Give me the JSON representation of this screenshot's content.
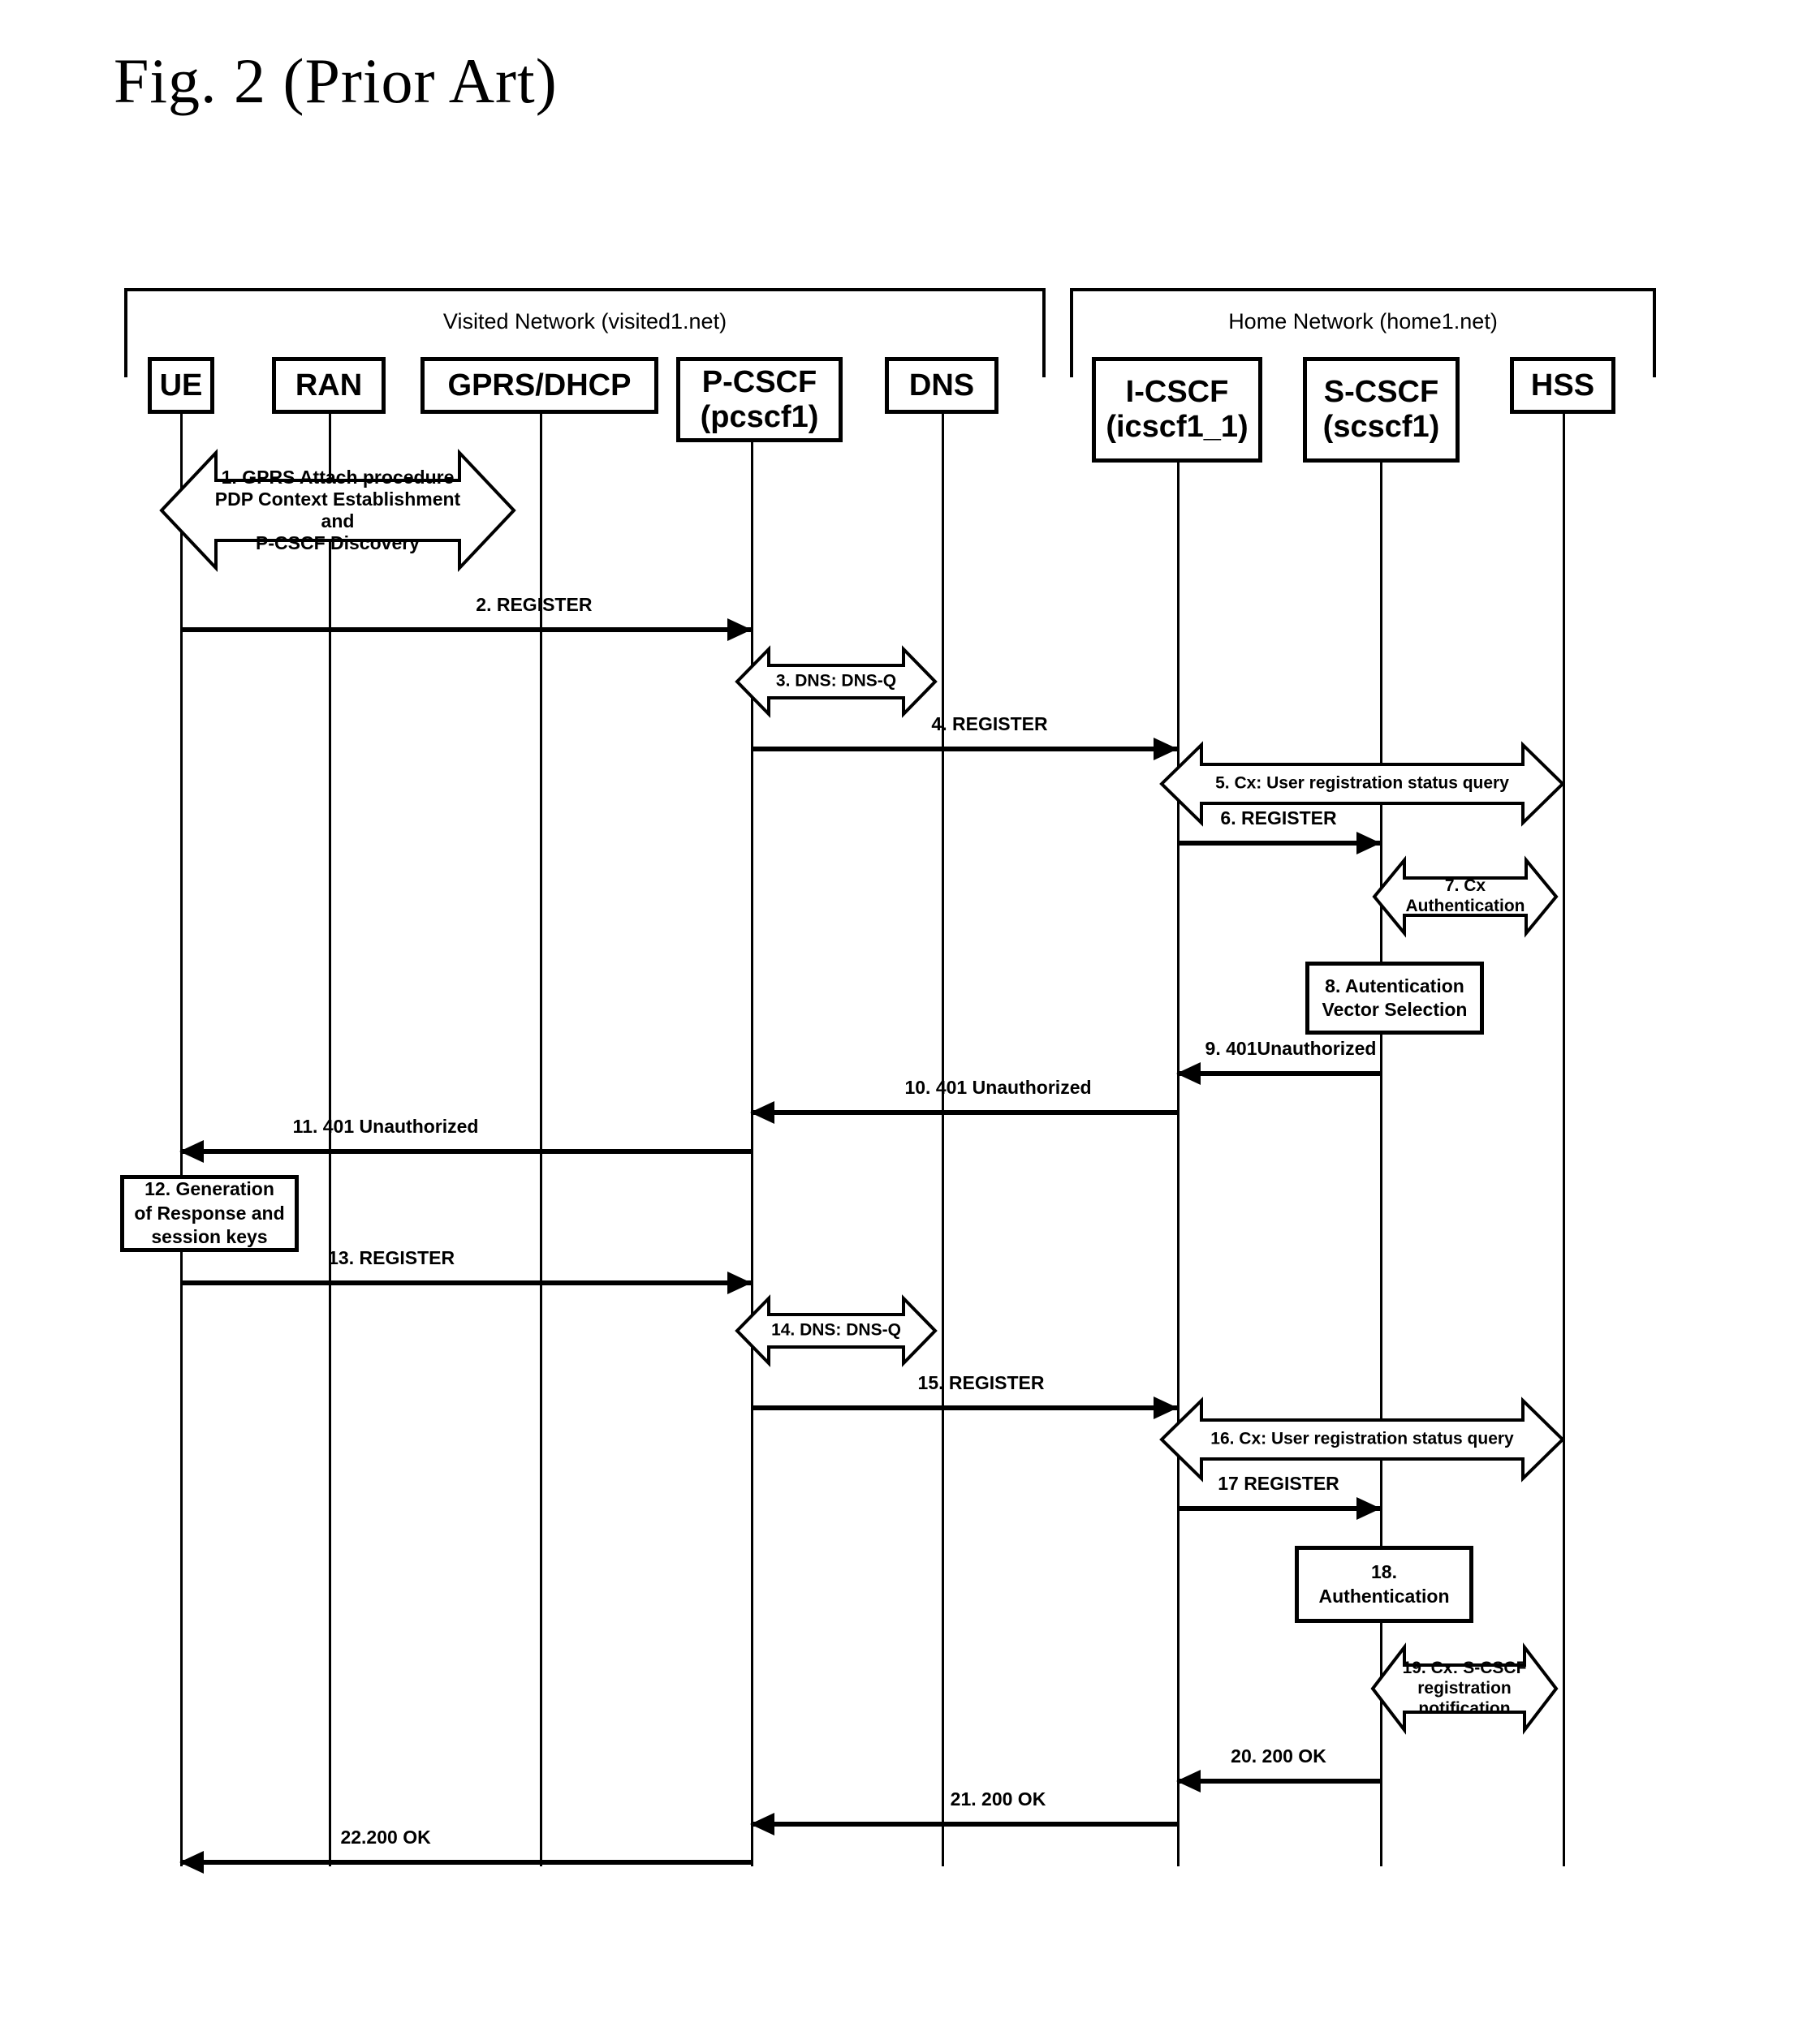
{
  "figure": {
    "title": "Fig. 2 (Prior Art)"
  },
  "networks": [
    {
      "id": "visited",
      "label": "Visited Network (visited1.net)"
    },
    {
      "id": "home",
      "label": "Home Network (home1.net)"
    }
  ],
  "entities": [
    {
      "id": "ue",
      "line1": "UE",
      "line2": ""
    },
    {
      "id": "ran",
      "line1": "RAN",
      "line2": ""
    },
    {
      "id": "gprs",
      "line1": "GPRS/DHCP",
      "line2": ""
    },
    {
      "id": "pcscf",
      "line1": "P-CSCF",
      "line2": "(pcscf1)"
    },
    {
      "id": "dns",
      "line1": "DNS",
      "line2": ""
    },
    {
      "id": "icscf",
      "line1": "I-CSCF",
      "line2": "(icscf1_1)"
    },
    {
      "id": "scscf",
      "line1": "S-CSCF",
      "line2": "(scscf1)"
    },
    {
      "id": "hss",
      "line1": "HSS",
      "line2": ""
    }
  ],
  "steps": {
    "s1": "1. GPRS Attach procedure\nPDP Context Establishment\nand\nP-CSCF Discovery",
    "s2": "2. REGISTER",
    "s3": "3. DNS: DNS-Q",
    "s4": "4. REGISTER",
    "s5": "5. Cx: User registration status query",
    "s6": "6. REGISTER",
    "s7": "7. Cx\nAuthentication",
    "s8": "8. Autentication\nVector Selection",
    "s9": "9. 401Unauthorized",
    "s10": "10. 401 Unauthorized",
    "s11": "11. 401 Unauthorized",
    "s12": "12. Generation\nof Response and\nsession keys",
    "s13": "13. REGISTER",
    "s14": "14. DNS: DNS-Q",
    "s15": "15. REGISTER",
    "s16": "16. Cx: User registration status query",
    "s17": "17 REGISTER",
    "s18": "18.\nAuthentication",
    "s19": "19. Cx: S-CSCF\nregistration\nnotification",
    "s20": "20. 200 OK",
    "s21": "21. 200 OK",
    "s22": "22.200 OK"
  },
  "colors": {
    "ink": "#000000",
    "paper": "#ffffff"
  }
}
